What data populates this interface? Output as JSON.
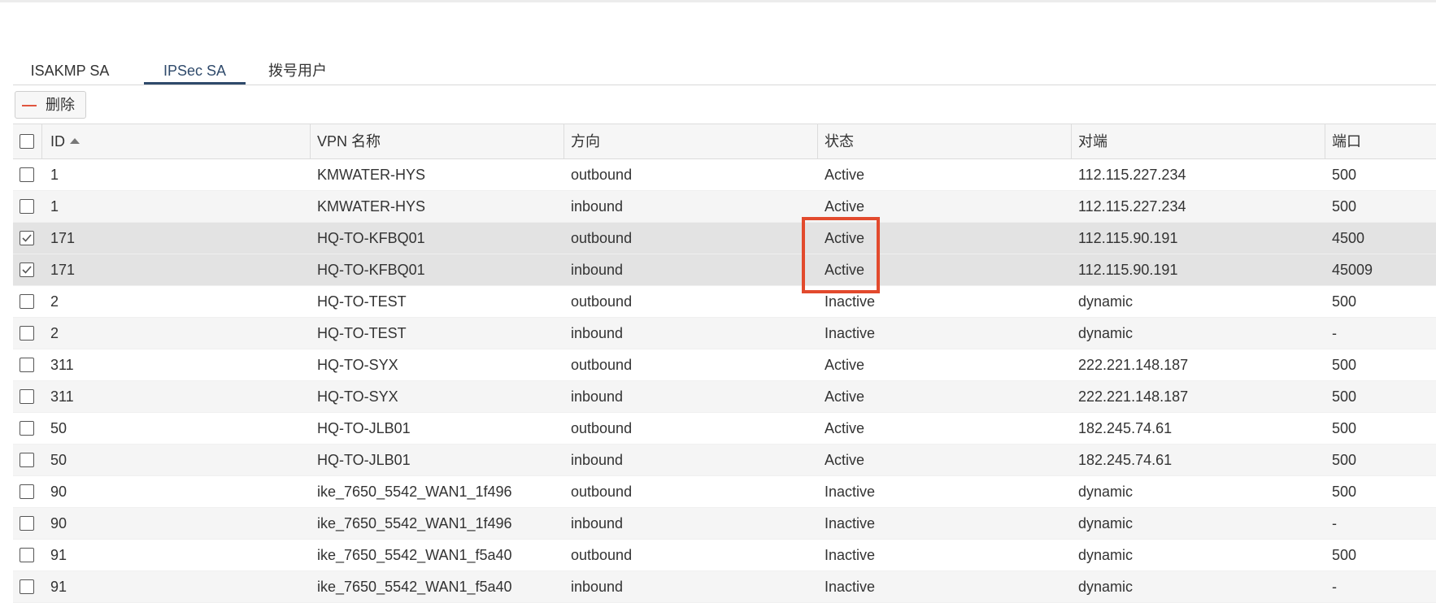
{
  "tabs": [
    {
      "label": "ISAKMP SA",
      "active": false
    },
    {
      "label": "IPSec SA",
      "active": true
    },
    {
      "label": "拨号用户",
      "active": false
    }
  ],
  "toolbar": {
    "delete_label": "删除"
  },
  "table": {
    "columns": [
      "ID",
      "VPN 名称",
      "方向",
      "状态",
      "对端",
      "端口"
    ],
    "sort": {
      "column": "ID",
      "direction": "ascending"
    },
    "rows": [
      {
        "checked": false,
        "id": "1",
        "vpn": "KMWATER-HYS",
        "direction": "outbound",
        "status": "Active",
        "peer": "112.115.227.234",
        "port": "500"
      },
      {
        "checked": false,
        "id": "1",
        "vpn": "KMWATER-HYS",
        "direction": "inbound",
        "status": "Active",
        "peer": "112.115.227.234",
        "port": "500"
      },
      {
        "checked": true,
        "id": "171",
        "vpn": "HQ-TO-KFBQ01",
        "direction": "outbound",
        "status": "Active",
        "peer": "112.115.90.191",
        "port": "4500"
      },
      {
        "checked": true,
        "id": "171",
        "vpn": "HQ-TO-KFBQ01",
        "direction": "inbound",
        "status": "Active",
        "peer": "112.115.90.191",
        "port": "45009"
      },
      {
        "checked": false,
        "id": "2",
        "vpn": "HQ-TO-TEST",
        "direction": "outbound",
        "status": "Inactive",
        "peer": "dynamic",
        "port": "500"
      },
      {
        "checked": false,
        "id": "2",
        "vpn": "HQ-TO-TEST",
        "direction": "inbound",
        "status": "Inactive",
        "peer": "dynamic",
        "port": "-"
      },
      {
        "checked": false,
        "id": "311",
        "vpn": "HQ-TO-SYX",
        "direction": "outbound",
        "status": "Active",
        "peer": "222.221.148.187",
        "port": "500"
      },
      {
        "checked": false,
        "id": "311",
        "vpn": "HQ-TO-SYX",
        "direction": "inbound",
        "status": "Active",
        "peer": "222.221.148.187",
        "port": "500"
      },
      {
        "checked": false,
        "id": "50",
        "vpn": "HQ-TO-JLB01",
        "direction": "outbound",
        "status": "Active",
        "peer": "182.245.74.61",
        "port": "500"
      },
      {
        "checked": false,
        "id": "50",
        "vpn": "HQ-TO-JLB01",
        "direction": "inbound",
        "status": "Active",
        "peer": "182.245.74.61",
        "port": "500"
      },
      {
        "checked": false,
        "id": "90",
        "vpn": "ike_7650_5542_WAN1_1f496",
        "direction": "outbound",
        "status": "Inactive",
        "peer": "dynamic",
        "port": "500"
      },
      {
        "checked": false,
        "id": "90",
        "vpn": "ike_7650_5542_WAN1_1f496",
        "direction": "inbound",
        "status": "Inactive",
        "peer": "dynamic",
        "port": "-"
      },
      {
        "checked": false,
        "id": "91",
        "vpn": "ike_7650_5542_WAN1_f5a40",
        "direction": "outbound",
        "status": "Inactive",
        "peer": "dynamic",
        "port": "500"
      },
      {
        "checked": false,
        "id": "91",
        "vpn": "ike_7650_5542_WAN1_f5a40",
        "direction": "inbound",
        "status": "Inactive",
        "peer": "dynamic",
        "port": "-"
      }
    ]
  },
  "colors": {
    "active_tab": "#2f4a6b",
    "highlight_box": "#e24a2d",
    "delete_icon": "#e0553f",
    "selected_row": "#e3e3e3",
    "alt_row": "#f5f5f5"
  },
  "icons": {
    "delete": "minus-icon",
    "sort": "sort-ascending-icon",
    "checkbox": "checkbox-icon"
  }
}
